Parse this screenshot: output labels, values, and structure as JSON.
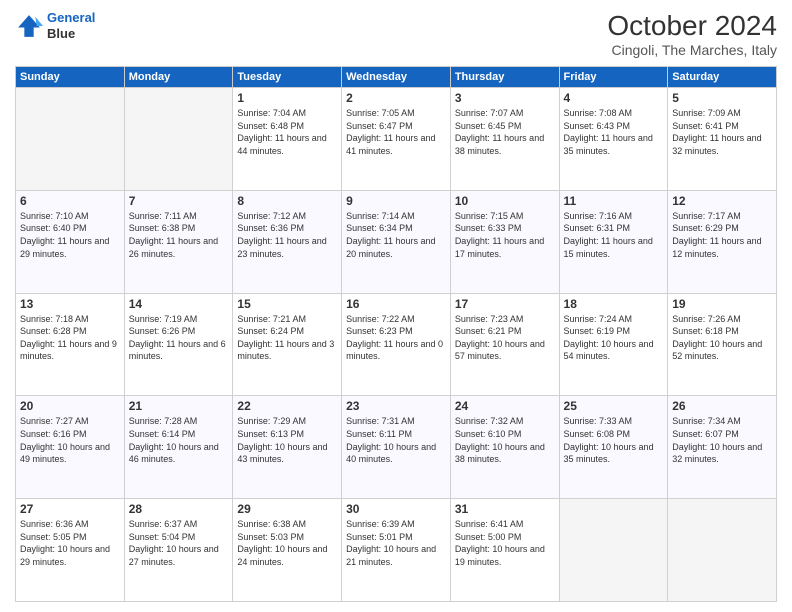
{
  "header": {
    "logo_line1": "General",
    "logo_line2": "Blue",
    "month": "October 2024",
    "location": "Cingoli, The Marches, Italy"
  },
  "weekdays": [
    "Sunday",
    "Monday",
    "Tuesday",
    "Wednesday",
    "Thursday",
    "Friday",
    "Saturday"
  ],
  "weeks": [
    [
      {
        "day": "",
        "info": ""
      },
      {
        "day": "",
        "info": ""
      },
      {
        "day": "1",
        "info": "Sunrise: 7:04 AM\nSunset: 6:48 PM\nDaylight: 11 hours and 44 minutes."
      },
      {
        "day": "2",
        "info": "Sunrise: 7:05 AM\nSunset: 6:47 PM\nDaylight: 11 hours and 41 minutes."
      },
      {
        "day": "3",
        "info": "Sunrise: 7:07 AM\nSunset: 6:45 PM\nDaylight: 11 hours and 38 minutes."
      },
      {
        "day": "4",
        "info": "Sunrise: 7:08 AM\nSunset: 6:43 PM\nDaylight: 11 hours and 35 minutes."
      },
      {
        "day": "5",
        "info": "Sunrise: 7:09 AM\nSunset: 6:41 PM\nDaylight: 11 hours and 32 minutes."
      }
    ],
    [
      {
        "day": "6",
        "info": "Sunrise: 7:10 AM\nSunset: 6:40 PM\nDaylight: 11 hours and 29 minutes."
      },
      {
        "day": "7",
        "info": "Sunrise: 7:11 AM\nSunset: 6:38 PM\nDaylight: 11 hours and 26 minutes."
      },
      {
        "day": "8",
        "info": "Sunrise: 7:12 AM\nSunset: 6:36 PM\nDaylight: 11 hours and 23 minutes."
      },
      {
        "day": "9",
        "info": "Sunrise: 7:14 AM\nSunset: 6:34 PM\nDaylight: 11 hours and 20 minutes."
      },
      {
        "day": "10",
        "info": "Sunrise: 7:15 AM\nSunset: 6:33 PM\nDaylight: 11 hours and 17 minutes."
      },
      {
        "day": "11",
        "info": "Sunrise: 7:16 AM\nSunset: 6:31 PM\nDaylight: 11 hours and 15 minutes."
      },
      {
        "day": "12",
        "info": "Sunrise: 7:17 AM\nSunset: 6:29 PM\nDaylight: 11 hours and 12 minutes."
      }
    ],
    [
      {
        "day": "13",
        "info": "Sunrise: 7:18 AM\nSunset: 6:28 PM\nDaylight: 11 hours and 9 minutes."
      },
      {
        "day": "14",
        "info": "Sunrise: 7:19 AM\nSunset: 6:26 PM\nDaylight: 11 hours and 6 minutes."
      },
      {
        "day": "15",
        "info": "Sunrise: 7:21 AM\nSunset: 6:24 PM\nDaylight: 11 hours and 3 minutes."
      },
      {
        "day": "16",
        "info": "Sunrise: 7:22 AM\nSunset: 6:23 PM\nDaylight: 11 hours and 0 minutes."
      },
      {
        "day": "17",
        "info": "Sunrise: 7:23 AM\nSunset: 6:21 PM\nDaylight: 10 hours and 57 minutes."
      },
      {
        "day": "18",
        "info": "Sunrise: 7:24 AM\nSunset: 6:19 PM\nDaylight: 10 hours and 54 minutes."
      },
      {
        "day": "19",
        "info": "Sunrise: 7:26 AM\nSunset: 6:18 PM\nDaylight: 10 hours and 52 minutes."
      }
    ],
    [
      {
        "day": "20",
        "info": "Sunrise: 7:27 AM\nSunset: 6:16 PM\nDaylight: 10 hours and 49 minutes."
      },
      {
        "day": "21",
        "info": "Sunrise: 7:28 AM\nSunset: 6:14 PM\nDaylight: 10 hours and 46 minutes."
      },
      {
        "day": "22",
        "info": "Sunrise: 7:29 AM\nSunset: 6:13 PM\nDaylight: 10 hours and 43 minutes."
      },
      {
        "day": "23",
        "info": "Sunrise: 7:31 AM\nSunset: 6:11 PM\nDaylight: 10 hours and 40 minutes."
      },
      {
        "day": "24",
        "info": "Sunrise: 7:32 AM\nSunset: 6:10 PM\nDaylight: 10 hours and 38 minutes."
      },
      {
        "day": "25",
        "info": "Sunrise: 7:33 AM\nSunset: 6:08 PM\nDaylight: 10 hours and 35 minutes."
      },
      {
        "day": "26",
        "info": "Sunrise: 7:34 AM\nSunset: 6:07 PM\nDaylight: 10 hours and 32 minutes."
      }
    ],
    [
      {
        "day": "27",
        "info": "Sunrise: 6:36 AM\nSunset: 5:05 PM\nDaylight: 10 hours and 29 minutes."
      },
      {
        "day": "28",
        "info": "Sunrise: 6:37 AM\nSunset: 5:04 PM\nDaylight: 10 hours and 27 minutes."
      },
      {
        "day": "29",
        "info": "Sunrise: 6:38 AM\nSunset: 5:03 PM\nDaylight: 10 hours and 24 minutes."
      },
      {
        "day": "30",
        "info": "Sunrise: 6:39 AM\nSunset: 5:01 PM\nDaylight: 10 hours and 21 minutes."
      },
      {
        "day": "31",
        "info": "Sunrise: 6:41 AM\nSunset: 5:00 PM\nDaylight: 10 hours and 19 minutes."
      },
      {
        "day": "",
        "info": ""
      },
      {
        "day": "",
        "info": ""
      }
    ]
  ]
}
